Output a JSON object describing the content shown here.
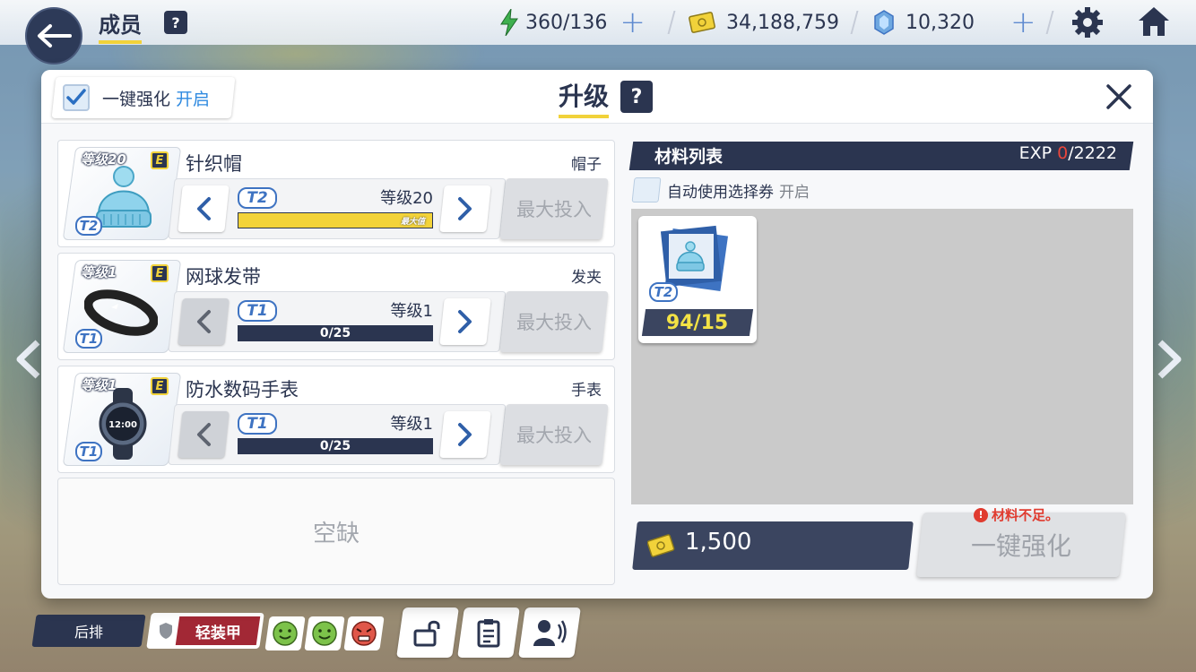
{
  "topbar": {
    "title": "成员",
    "help": "?",
    "ap": "360/136",
    "credits": "34,188,759",
    "gems": "10,320"
  },
  "modal": {
    "auto_label": "一键强化",
    "auto_state": "开启",
    "title": "升级",
    "help": "?"
  },
  "equipment": [
    {
      "thumb_level": "等级20",
      "grade": "E",
      "tier": "T2",
      "name": "针织帽",
      "type": "帽子",
      "level": "等级20",
      "exp_fill": 1.0,
      "exp_text": "",
      "max_tag": "最大值",
      "max_button": "最大投入"
    },
    {
      "thumb_level": "等级1",
      "grade": "E",
      "tier": "T1",
      "name": "网球发带",
      "type": "发夹",
      "level": "等级1",
      "exp_fill": 0.0,
      "exp_text": "0/25",
      "max_tag": "",
      "max_button": "最大投入"
    },
    {
      "thumb_level": "等级1",
      "grade": "E",
      "tier": "T1",
      "name": "防水数码手表",
      "type": "手表",
      "level": "等级1",
      "exp_fill": 0.0,
      "exp_text": "0/25",
      "max_tag": "",
      "max_button": "最大投入"
    }
  ],
  "empty_slot": "空缺",
  "materials": {
    "header": "材料列表",
    "exp_label": "EXP",
    "exp_current": "0",
    "exp_total": "/2222",
    "auto_ticket_label": "自动使用选择券",
    "auto_ticket_state": "开启",
    "items": [
      {
        "tier": "T2",
        "count": "94/15"
      }
    ]
  },
  "cost": "1,500",
  "upgrade_button": "一键强化",
  "warning": "材料不足。",
  "bottom": {
    "position": "后排",
    "armor": "轻装甲"
  },
  "colors": {
    "navy": "#2b3550",
    "yellow": "#f1d23a",
    "accent_blue": "#2f8ae0",
    "warning_red": "#e03b2f",
    "armor_red": "#a22835"
  }
}
